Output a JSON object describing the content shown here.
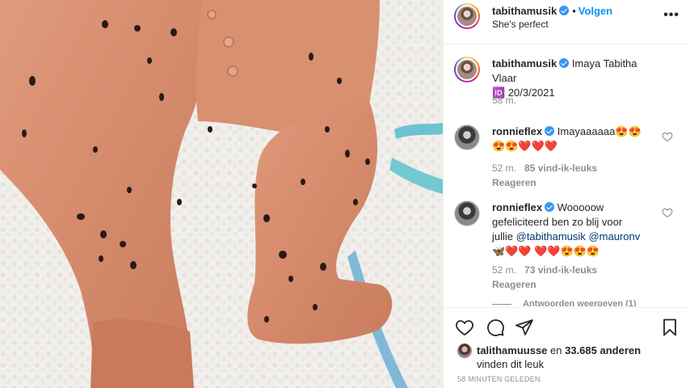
{
  "header": {
    "username": "tabithamusik",
    "dot": "•",
    "follow_label": "Volgen",
    "location": "She's perfect",
    "more_label": "•••"
  },
  "caption": {
    "username": "tabithamusik",
    "text_line1": "Imaya Tabitha Vlaar",
    "text_line2": "🆔 20/3/2021",
    "age": "58 m."
  },
  "comments": [
    {
      "username": "ronnieflex",
      "text": "Imayaaaaaa😍😍",
      "text_line2": "😍😍❤️❤️❤️",
      "age": "52 m.",
      "likes": "85 vind-ik-leuks",
      "reply_label": "Reageren"
    },
    {
      "username": "ronnieflex",
      "text": "Wooooow",
      "text_line2": "gefeliciteerd ben zo blij voor",
      "text_line3_prefix": "jullie ",
      "mention1": "@tabithamusik",
      "mention2": "@mauronv",
      "text_line4": "🦋❤️❤️ ❤️❤️😍😍😍",
      "age": "52 m.",
      "likes": "73 vind-ik-leuks",
      "reply_label": "Reageren",
      "view_replies": "Antwoorden weergeven (1)"
    }
  ],
  "footer": {
    "liked_by": "talithamuusse",
    "liked_and": " en ",
    "liked_count": "33.685 anderen",
    "liked_suffix": "vinden dit leuk",
    "timestamp": "58 MINUTEN GELEDEN"
  },
  "colors": {
    "accent": "#0095f6",
    "verified": "#3897f0",
    "secondary_text": "#8e8e8e",
    "onesie": "#d98f70"
  },
  "icons": [
    "heart-icon",
    "comment-icon",
    "share-icon",
    "bookmark-icon",
    "verified-badge-icon",
    "more-options-icon"
  ]
}
